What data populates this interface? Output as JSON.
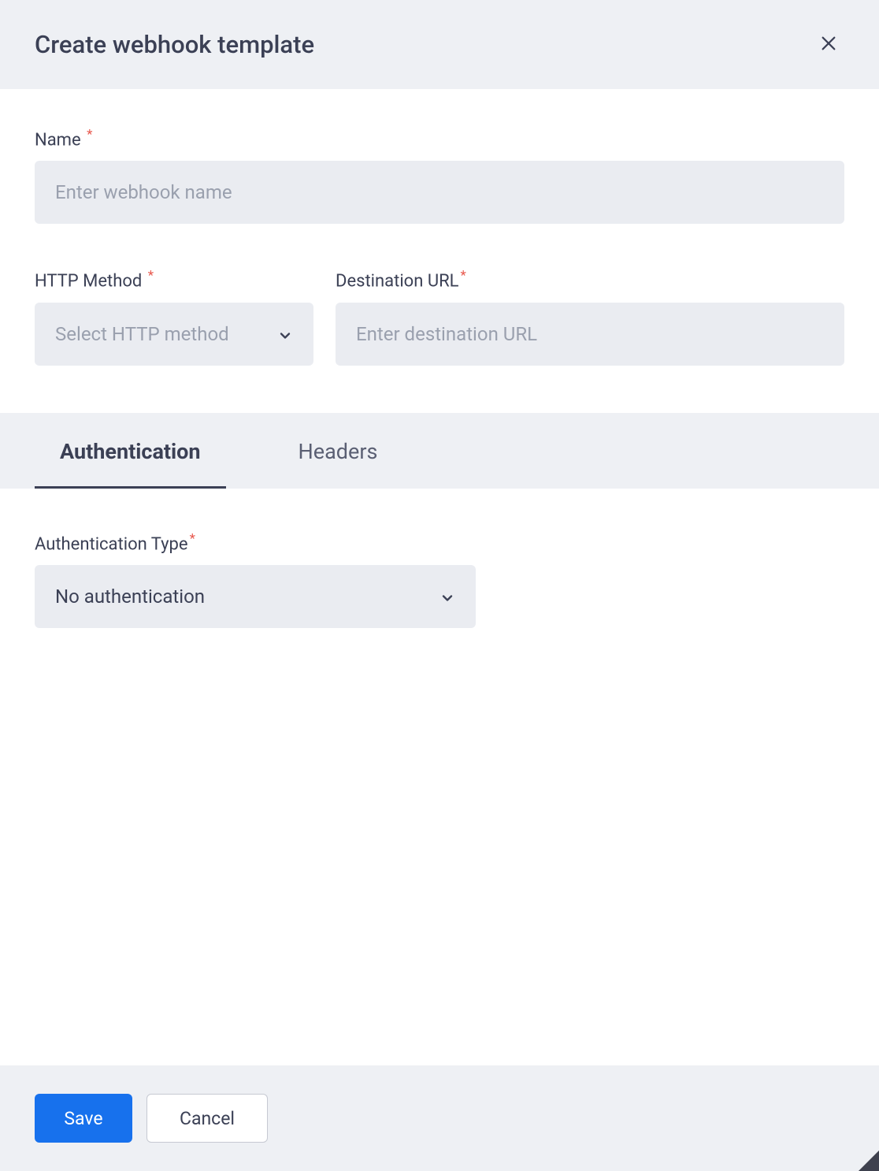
{
  "header": {
    "title": "Create webhook template"
  },
  "form": {
    "name": {
      "label": "Name",
      "placeholder": "Enter webhook name",
      "value": ""
    },
    "http_method": {
      "label": "HTTP Method",
      "placeholder": "Select HTTP method",
      "selected": ""
    },
    "destination_url": {
      "label": "Destination URL",
      "placeholder": "Enter destination URL",
      "value": ""
    }
  },
  "tabs": {
    "items": [
      {
        "label": "Authentication",
        "active": true
      },
      {
        "label": "Headers",
        "active": false
      }
    ]
  },
  "auth": {
    "type_label": "Authentication Type",
    "selected": "No authentication"
  },
  "footer": {
    "save_label": "Save",
    "cancel_label": "Cancel"
  },
  "required_marker": "*"
}
